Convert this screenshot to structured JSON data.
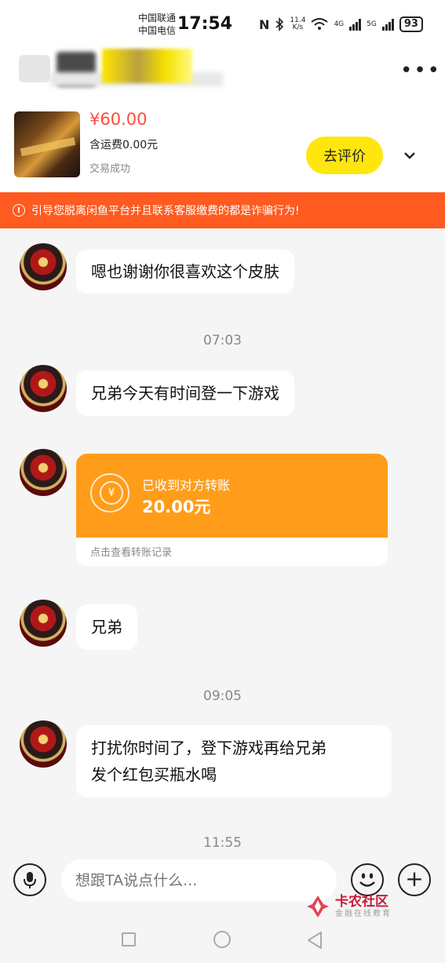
{
  "status_bar": {
    "carrier1": "中国联通",
    "carrier2": "中国电信",
    "time": "17:54",
    "nfc": "N",
    "net_speed_value": "11.4",
    "net_speed_unit": "K/s",
    "net_4g": "4G",
    "net_5g": "5G",
    "battery": "93"
  },
  "product": {
    "price": "¥60.00",
    "shipping": "含运费0.00元",
    "status": "交易成功",
    "review_button": "去评价"
  },
  "warning": {
    "icon_text": "!",
    "text": "引导您脱离闲鱼平台并且联系客服缴费的都是诈骗行为!"
  },
  "messages": [
    {
      "text": "嗯也谢谢你很喜欢这个皮肤"
    },
    {
      "timestamp": "07:03"
    },
    {
      "text": "兄弟今天有时间登一下游戏"
    },
    {
      "transfer": {
        "label": "已收到对方转账",
        "amount": "20.00元",
        "link": "点击查看转账记录"
      }
    },
    {
      "text": "兄弟"
    },
    {
      "timestamp": "09:05"
    },
    {
      "text_line1": "打扰你时间了，登下游戏再给兄弟",
      "text_line2": "发个红包买瓶水喝"
    },
    {
      "timestamp": "11:55"
    }
  ],
  "input_bar": {
    "placeholder": "想跟TA说点什么..."
  },
  "watermark": {
    "title": "卡农社区",
    "subtitle": "金融在线教育"
  },
  "colors": {
    "accent_yellow": "#ffe60f",
    "warning_orange": "#ff5a1f",
    "transfer_orange": "#ff9d1a",
    "price_red": "#ff4b3a"
  }
}
